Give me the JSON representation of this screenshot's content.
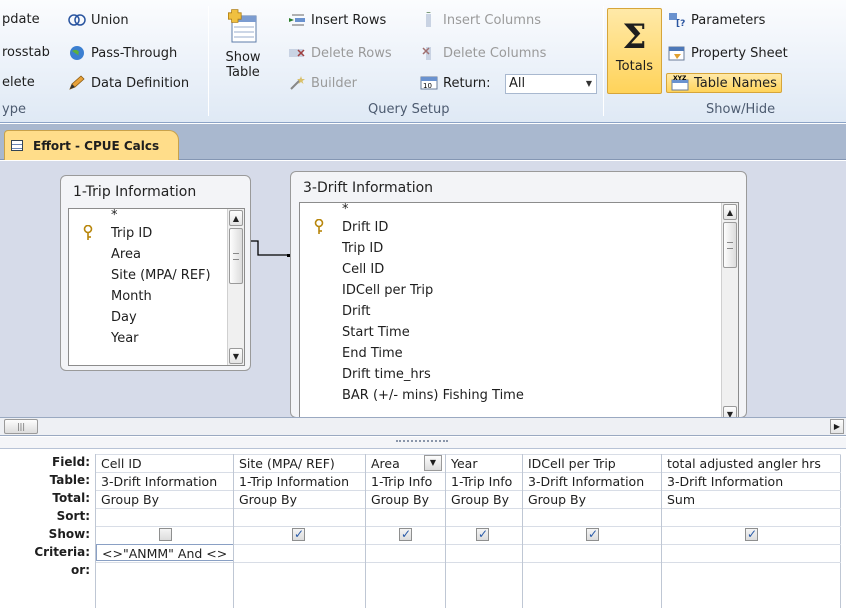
{
  "ribbon": {
    "query_type": {
      "update": "pdate",
      "crosstab": "rosstab",
      "delete": "elete",
      "union": "Union",
      "pass_through": "Pass-Through",
      "data_definition": "Data Definition",
      "group_label": "ype"
    },
    "query_setup": {
      "show_table_line1": "Show",
      "show_table_line2": "Table",
      "insert_rows": "Insert Rows",
      "delete_rows": "Delete Rows",
      "builder": "Builder",
      "insert_columns": "Insert Columns",
      "delete_columns": "Delete Columns",
      "return_label": "Return:",
      "return_value": "All",
      "group_label": "Query Setup"
    },
    "show_hide": {
      "totals": "Totals",
      "parameters": "Parameters",
      "property_sheet": "Property Sheet",
      "table_names": "Table Names",
      "group_label": "Show/Hide"
    }
  },
  "document_tab": {
    "title": "Effort - CPUE Calcs"
  },
  "tables": {
    "trip": {
      "title": "1-Trip Information",
      "fields": [
        "*",
        "Trip ID",
        "Area",
        "Site (MPA/ REF)",
        "Month",
        "Day",
        "Year"
      ]
    },
    "drift": {
      "title": "3-Drift Information",
      "fields": [
        "*",
        "Drift ID",
        "Trip ID",
        "Cell ID",
        "IDCell per Trip",
        "Drift",
        "Start Time",
        "End Time",
        "Drift time_hrs",
        "BAR (+/- mins) Fishing Time"
      ]
    }
  },
  "grid": {
    "row_labels": [
      "Field:",
      "Table:",
      "Total:",
      "Sort:",
      "Show:",
      "Criteria:",
      "or:"
    ],
    "columns": [
      {
        "field": "Cell ID",
        "table": "3-Drift Information",
        "total": "Group By",
        "sort": "",
        "show": false,
        "criteria": "<>\"ANMM\" And <>",
        "or": ""
      },
      {
        "field": "Site (MPA/ REF)",
        "table": "1-Trip Information",
        "total": "Group By",
        "sort": "",
        "show": true,
        "criteria": "",
        "or": ""
      },
      {
        "field": "Area",
        "table": "1-Trip Info",
        "total": "Group By",
        "sort": "",
        "show": true,
        "criteria": "",
        "or": ""
      },
      {
        "field": "Year",
        "table": "1-Trip Info",
        "total": "Group By",
        "sort": "",
        "show": true,
        "criteria": "",
        "or": ""
      },
      {
        "field": "IDCell per Trip",
        "table": "3-Drift Information",
        "total": "Group By",
        "sort": "",
        "show": true,
        "criteria": "",
        "or": ""
      },
      {
        "field": "total adjusted angler hrs",
        "table": "3-Drift Information",
        "total": "Sum",
        "sort": "",
        "show": true,
        "criteria": "",
        "or": ""
      }
    ]
  }
}
